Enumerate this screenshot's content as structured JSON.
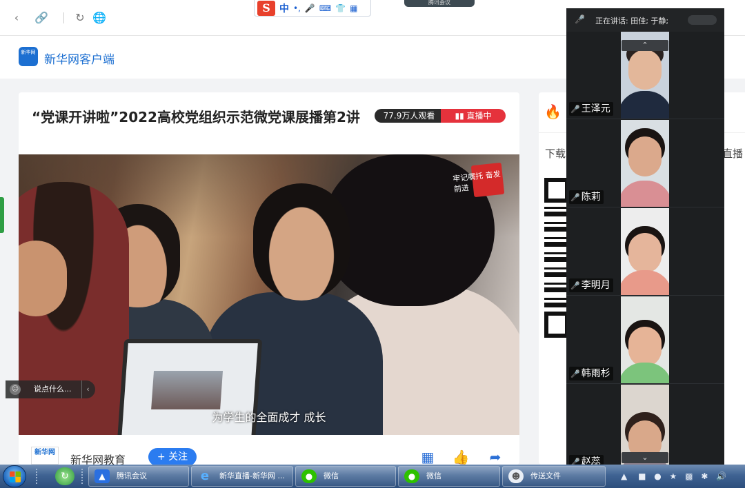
{
  "ime": {
    "logo": "S",
    "lang": "中",
    "icons": [
      "punct-icon",
      "mic-icon",
      "keyboard-icon",
      "shirt-icon",
      "grid-icon"
    ]
  },
  "meeting_pill": "腾讯会议",
  "site": {
    "name": "新华网客户端",
    "logo_text": "新华网"
  },
  "article": {
    "title": "“党课开讲啦”2022高校党组织示范微党课展播第2讲",
    "views": "77.9万人观看",
    "live": "直播中",
    "subtitle": "为学生的全面成才 成长",
    "seal_text": "牢记嘱托 奋发前进",
    "comment_placeholder": "说点什么...",
    "author": {
      "logo_text": "新华网",
      "name": "新华网教育",
      "follow": "+ 关注"
    }
  },
  "right_panel": {
    "download_left": "下载",
    "download_right": "直播"
  },
  "meeting": {
    "speaking": "正在讲话: 田佳; 于静;",
    "participants": [
      {
        "name": "王泽元"
      },
      {
        "name": "陈莉"
      },
      {
        "name": "李明月"
      },
      {
        "name": "韩雨杉"
      },
      {
        "name": "赵蕊"
      }
    ]
  },
  "taskbar": {
    "tasks": [
      {
        "label": "腾讯会议"
      },
      {
        "label": "新华直播-新华网 ..."
      },
      {
        "label": "微信"
      },
      {
        "label": "微信"
      },
      {
        "label": "传送文件"
      }
    ]
  },
  "colors": {
    "brand": "#1c6fd1",
    "live_red": "#e5323c",
    "follow_blue": "#2b7cf0"
  }
}
